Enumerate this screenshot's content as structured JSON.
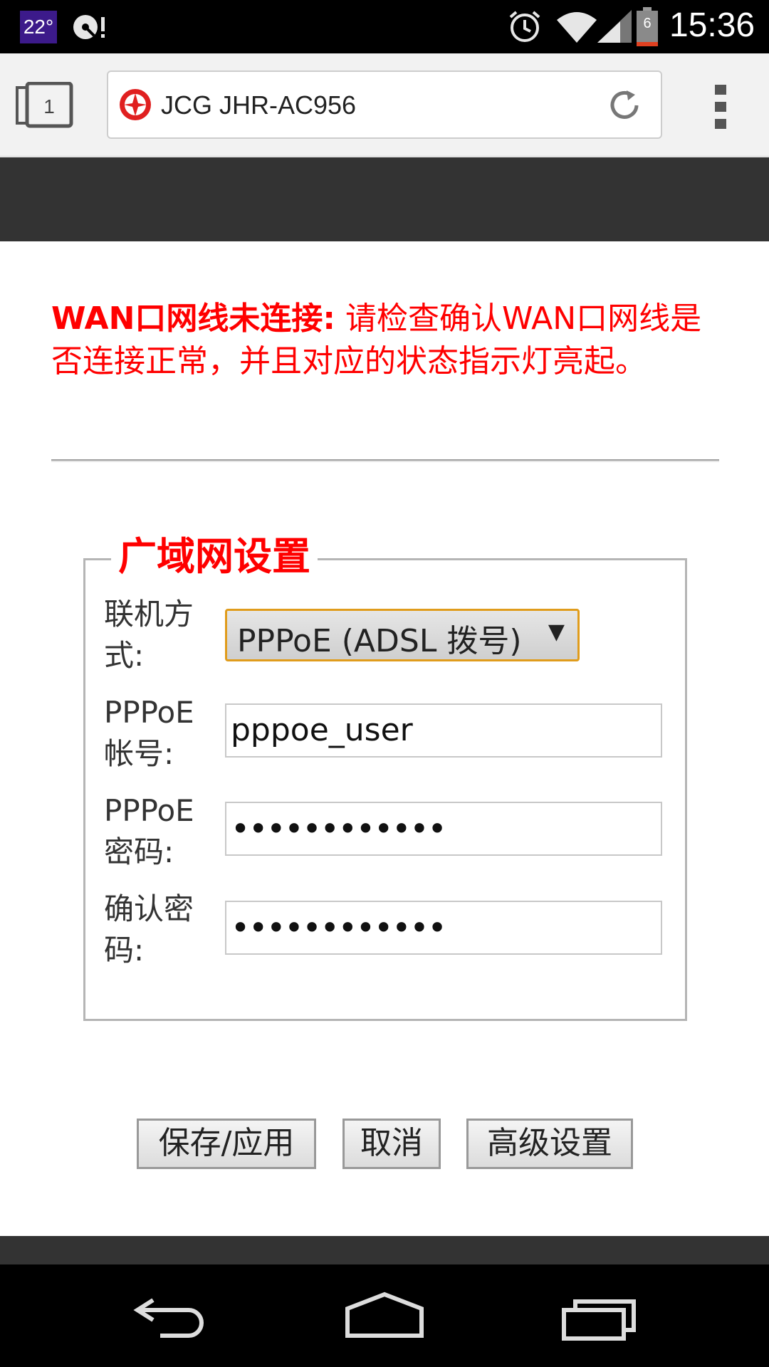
{
  "status_bar": {
    "temperature": "22°",
    "battery_level": "6",
    "time": "15:36"
  },
  "browser": {
    "tab_count": "1",
    "page_title": "JCG JHR-AC956"
  },
  "warning": {
    "title": "WAN口网线未连接:",
    "message": " 请检查确认WAN口网线是否连接正常，并且对应的状态指示灯亮起。"
  },
  "wan_settings": {
    "legend": "广域网设置",
    "connection_type_label": "联机方式:",
    "connection_type_value": "PPPoE (ADSL 拨号)",
    "account_label": "PPPoE帐号:",
    "account_value": "pppoe_user",
    "password_label": "PPPoE密码:",
    "password_value": "••••••••••••",
    "confirm_label": "确认密码:",
    "confirm_value": "••••••••••••"
  },
  "buttons": {
    "save": "保存/应用",
    "cancel": "取消",
    "advanced": "高级设置"
  },
  "colors": {
    "warning_red": "#ff0000",
    "header_band": "#333333",
    "select_border": "#e09c1c"
  }
}
